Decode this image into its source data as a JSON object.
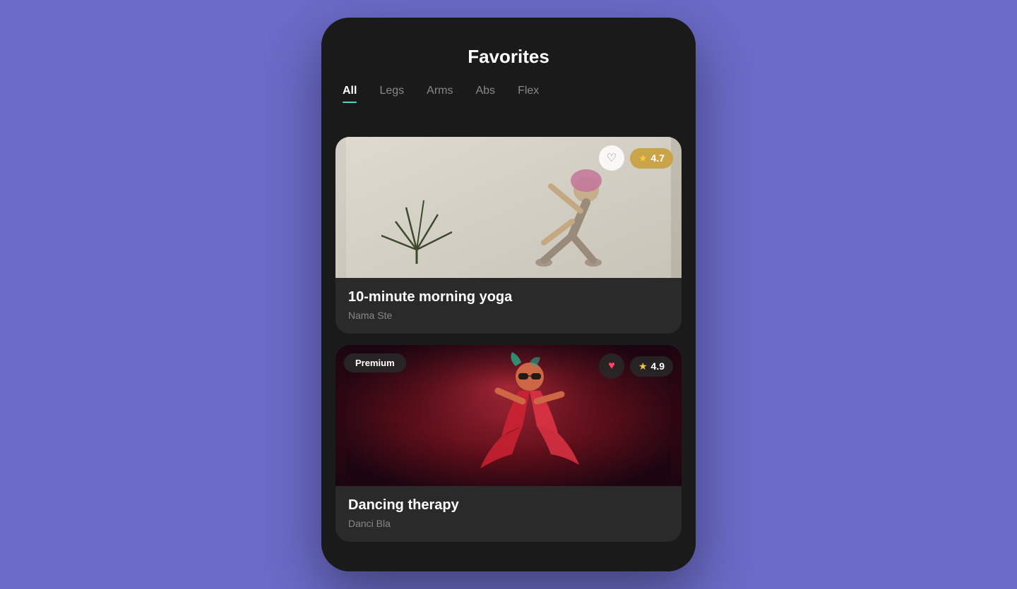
{
  "page": {
    "title": "Favorites",
    "background_color": "#6B6BC8"
  },
  "tabs": [
    {
      "id": "all",
      "label": "All",
      "active": true
    },
    {
      "id": "legs",
      "label": "Legs",
      "active": false
    },
    {
      "id": "arms",
      "label": "Arms",
      "active": false
    },
    {
      "id": "abs",
      "label": "Abs",
      "active": false
    },
    {
      "id": "flex",
      "label": "Flex",
      "active": false
    }
  ],
  "cards": [
    {
      "id": "yoga",
      "title": "10-minute morning yoga",
      "subtitle": "Nama Ste",
      "rating": "4.7",
      "is_premium": false,
      "heart_filled": false,
      "image_type": "yoga"
    },
    {
      "id": "dance",
      "title": "Dancing therapy",
      "subtitle": "Danci Bla",
      "rating": "4.9",
      "is_premium": true,
      "premium_label": "Premium",
      "heart_filled": true,
      "image_type": "dance"
    }
  ],
  "icons": {
    "heart_empty": "♡",
    "heart_filled": "♥",
    "star": "★"
  }
}
